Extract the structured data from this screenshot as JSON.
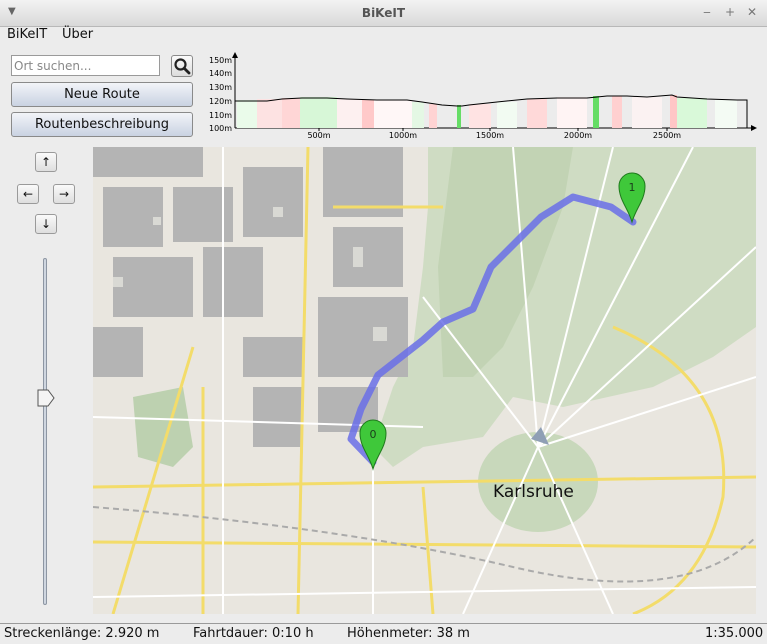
{
  "window": {
    "title": "BiKeIT"
  },
  "menu": {
    "items": [
      "BiKeIT",
      "Über"
    ]
  },
  "search": {
    "placeholder": "Ort suchen..."
  },
  "buttons": {
    "new_route": "Neue Route",
    "route_description": "Routenbeschreibung"
  },
  "navigation": {
    "up": "↑",
    "left": "←",
    "right": "→",
    "down": "↓"
  },
  "zoom": {
    "level": 0.59
  },
  "elevation_profile": {
    "y_ticks": [
      "150m",
      "140m",
      "130m",
      "120m",
      "110m",
      "100m"
    ],
    "x_ticks": [
      "500m",
      "1000m",
      "1500m",
      "2000m",
      "2500m"
    ]
  },
  "map": {
    "city_label": "Karlsruhe",
    "markers": [
      {
        "label": "0",
        "color": "#3fc83a"
      },
      {
        "label": "1",
        "color": "#3fc83a"
      }
    ],
    "route_color": "#6a6ee8"
  },
  "status": {
    "distance": "Streckenlänge: 2.920 m",
    "duration": "Fahrtdauer: 0:10 h",
    "elevation": "Höhenmeter: 38 m",
    "scale": "1:35.000"
  },
  "icons": {
    "search": "search-icon",
    "window_menu": "window-menu-icon",
    "minimize": "minimize-icon",
    "maximize": "maximize-icon",
    "close": "close-icon"
  }
}
